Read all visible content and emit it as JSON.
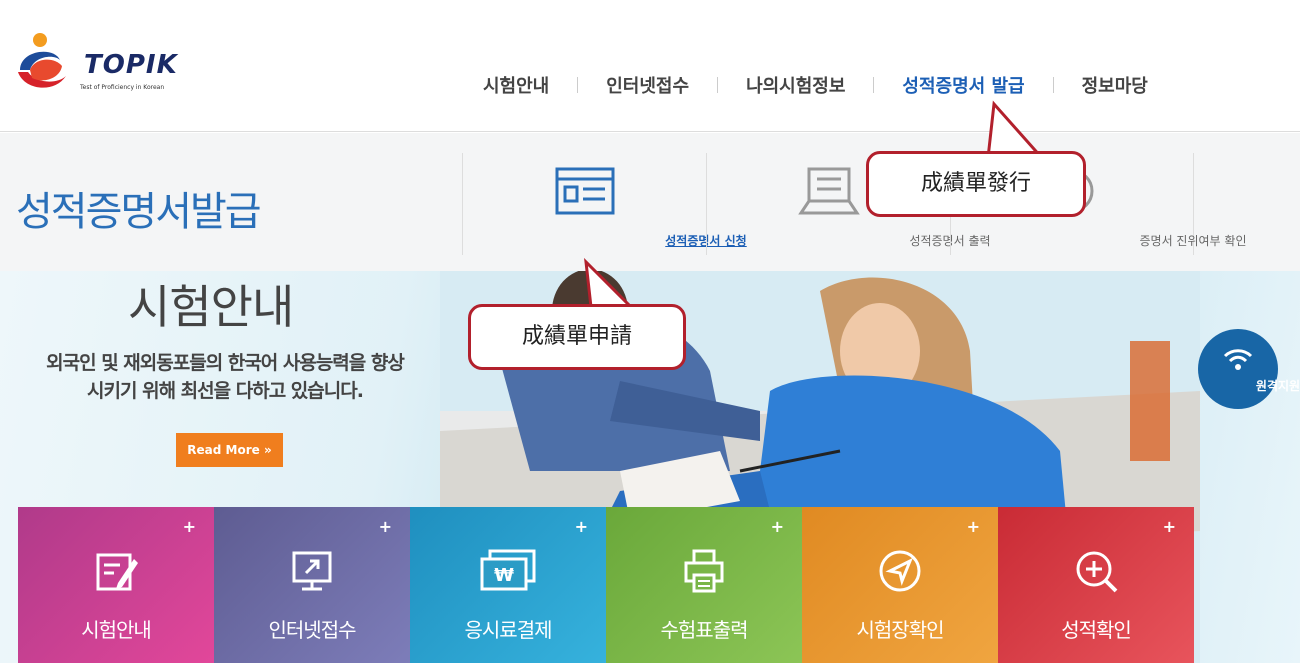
{
  "header": {
    "logo_word": "TOPIK",
    "logo_sub": "Test of Proficiency in Korean",
    "nav": [
      {
        "label": "시험안내",
        "active": false
      },
      {
        "label": "인터넷접수",
        "active": false
      },
      {
        "label": "나의시험정보",
        "active": false
      },
      {
        "label": "성적증명서 발급",
        "active": true
      },
      {
        "label": "정보마당",
        "active": false
      }
    ]
  },
  "subheader": {
    "title": "성적증명서발급",
    "items": [
      {
        "label": "성적증명서 신청",
        "icon": "form-icon",
        "active": true
      },
      {
        "label": "성적증명서 출력",
        "icon": "print-icon",
        "active": false
      },
      {
        "label": "증명서 진위여부 확인",
        "icon": "verify-icon",
        "active": false
      }
    ]
  },
  "hero": {
    "title": "시험안내",
    "desc_line1": "외국인 및 재외동포들의 한국어 사용능력을 향상",
    "desc_line2": "시키기 위해 최선을 다하고 있습니다.",
    "read_more": "Read More »"
  },
  "tiles": [
    {
      "label": "시험안내",
      "icon": "edit-icon",
      "color": "#c9378f"
    },
    {
      "label": "인터넷접수",
      "icon": "monitor-icon",
      "color": "#6f6ea8"
    },
    {
      "label": "응시료결제",
      "icon": "won-card-icon",
      "color": "#2b9cc6"
    },
    {
      "label": "수험표출력",
      "icon": "printer-icon",
      "color": "#7ab648"
    },
    {
      "label": "시험장확인",
      "icon": "navigation-icon",
      "color": "#e8962c"
    },
    {
      "label": "성적확인",
      "icon": "zoom-in-icon",
      "color": "#d9363e"
    }
  ],
  "remote": {
    "label": "원격지원"
  },
  "callouts": {
    "issue": "成績單發行",
    "apply": "成績單申請"
  },
  "colors": {
    "brand_blue": "#1c5fb5",
    "callout_border": "#b2202c",
    "read_more": "#f07e1e"
  }
}
